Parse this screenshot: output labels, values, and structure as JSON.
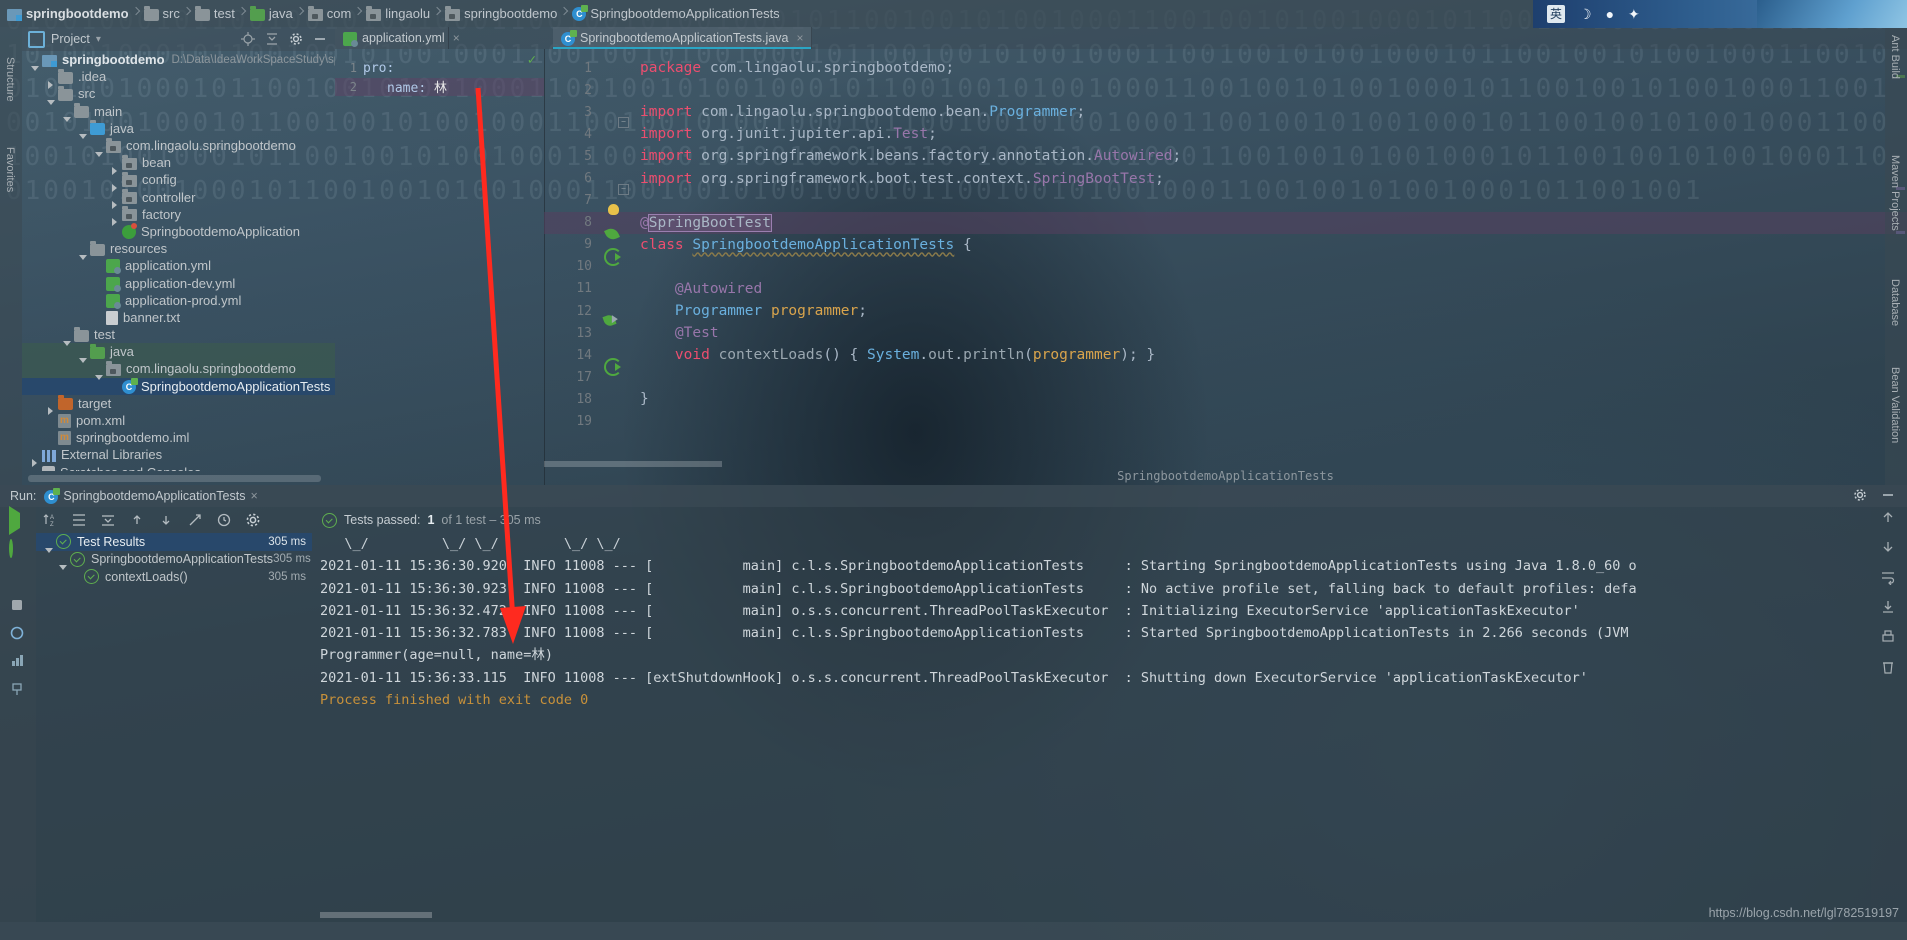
{
  "breadcrumb": {
    "items": [
      {
        "label": "springbootdemo",
        "icon": "module-icon",
        "bold": true
      },
      {
        "label": "src",
        "icon": "folder-icon"
      },
      {
        "label": "test",
        "icon": "folder-icon"
      },
      {
        "label": "java",
        "icon": "folder-green-icon"
      },
      {
        "label": "com",
        "icon": "package-icon"
      },
      {
        "label": "lingaolu",
        "icon": "package-icon"
      },
      {
        "label": "springbootdemo",
        "icon": "package-icon"
      },
      {
        "label": "SpringbootdemoApplicationTests",
        "icon": "class-test-icon"
      }
    ]
  },
  "project_panel": {
    "title": "Project",
    "tree": [
      {
        "indent": 0,
        "twist": "open",
        "icon": "module-icon",
        "label": "springbootdemo",
        "bold": true,
        "path": "D:\\Data\\IdeaWorkSpaceStudy\\springbootd"
      },
      {
        "indent": 1,
        "twist": "closed",
        "icon": "folder-icon",
        "label": ".idea"
      },
      {
        "indent": 1,
        "twist": "open",
        "icon": "folder-icon",
        "label": "src"
      },
      {
        "indent": 2,
        "twist": "open",
        "icon": "folder-icon",
        "label": "main"
      },
      {
        "indent": 3,
        "twist": "open",
        "icon": "folder-blue-icon",
        "label": "java"
      },
      {
        "indent": 4,
        "twist": "open",
        "icon": "package-icon",
        "label": "com.lingaolu.springbootdemo"
      },
      {
        "indent": 5,
        "twist": "closed",
        "icon": "package-icon",
        "label": "bean"
      },
      {
        "indent": 5,
        "twist": "closed",
        "icon": "package-icon",
        "label": "config"
      },
      {
        "indent": 5,
        "twist": "closed",
        "icon": "package-icon",
        "label": "controller"
      },
      {
        "indent": 5,
        "twist": "closed",
        "icon": "package-icon",
        "label": "factory"
      },
      {
        "indent": 5,
        "twist": "none",
        "icon": "spring-class-icon",
        "label": "SpringbootdemoApplication"
      },
      {
        "indent": 3,
        "twist": "open",
        "icon": "resources-icon",
        "label": "resources"
      },
      {
        "indent": 4,
        "twist": "none",
        "icon": "yml-icon",
        "label": "application.yml"
      },
      {
        "indent": 4,
        "twist": "none",
        "icon": "yml-icon",
        "label": "application-dev.yml"
      },
      {
        "indent": 4,
        "twist": "none",
        "icon": "yml-icon",
        "label": "application-prod.yml"
      },
      {
        "indent": 4,
        "twist": "none",
        "icon": "txt-icon",
        "label": "banner.txt"
      },
      {
        "indent": 2,
        "twist": "open",
        "icon": "folder-icon",
        "label": "test"
      },
      {
        "indent": 3,
        "twist": "open",
        "icon": "folder-green-icon",
        "label": "java",
        "highlight": "green"
      },
      {
        "indent": 4,
        "twist": "open",
        "icon": "package-icon",
        "label": "com.lingaolu.springbootdemo",
        "highlight": "green"
      },
      {
        "indent": 5,
        "twist": "none",
        "icon": "class-test-icon",
        "label": "SpringbootdemoApplicationTests",
        "highlight": "selected"
      },
      {
        "indent": 1,
        "twist": "closed",
        "icon": "folder-orange-icon",
        "label": "target"
      },
      {
        "indent": 1,
        "twist": "none",
        "icon": "xml-icon",
        "label": "pom.xml"
      },
      {
        "indent": 1,
        "twist": "none",
        "icon": "iml-icon",
        "label": "springbootdemo.iml"
      },
      {
        "indent": 0,
        "twist": "closed",
        "icon": "library-icon",
        "label": "External Libraries"
      },
      {
        "indent": 0,
        "twist": "closed",
        "icon": "scratch-icon",
        "label": "Scratches and Consoles"
      }
    ]
  },
  "editor": {
    "tabs": [
      {
        "label": "application.yml",
        "icon": "yml-icon",
        "active": false,
        "close": "×"
      },
      {
        "label": "SpringbootdemoApplicationTests.java",
        "icon": "class-test-icon",
        "active": true,
        "close": "×"
      }
    ],
    "yml": {
      "lines": [
        {
          "num": "1",
          "key": "pro",
          "colon": ":",
          "value": "",
          "highlight": false
        },
        {
          "num": "2",
          "key": "name",
          "colon": ":",
          "value": " 林",
          "highlight": true
        }
      ],
      "check_icon": "✓"
    },
    "java_lines": [
      {
        "num": "1",
        "marker": "",
        "text": "package com.lingaolu.springbootdemo;"
      },
      {
        "num": "2",
        "marker": "",
        "text": ""
      },
      {
        "num": "3",
        "marker": "fold",
        "text": "import com.lingaolu.springbootdemo.bean.Programmer;"
      },
      {
        "num": "4",
        "marker": "",
        "text": "import org.junit.jupiter.api.Test;"
      },
      {
        "num": "5",
        "marker": "",
        "text": "import org.springframework.beans.factory.annotation.Autowired;"
      },
      {
        "num": "6",
        "marker": "fold",
        "text": "import org.springframework.boot.test.context.SpringBootTest;"
      },
      {
        "num": "7",
        "marker": "bulb",
        "text": ""
      },
      {
        "num": "8",
        "marker": "leaf",
        "text": "@SpringBootTest",
        "current": true
      },
      {
        "num": "9",
        "marker": "run",
        "text": "class SpringbootdemoApplicationTests {"
      },
      {
        "num": "10",
        "marker": "",
        "text": ""
      },
      {
        "num": "11",
        "marker": "",
        "text": "    @Autowired"
      },
      {
        "num": "12",
        "marker": "bean",
        "text": "    Programmer programmer;"
      },
      {
        "num": "13",
        "marker": "",
        "text": "    @Test"
      },
      {
        "num": "14",
        "marker": "run",
        "text": "    void contextLoads() { System.out.println(programmer); }"
      },
      {
        "num": "17",
        "marker": "",
        "text": ""
      },
      {
        "num": "18",
        "marker": "",
        "text": "}"
      },
      {
        "num": "19",
        "marker": "",
        "text": ""
      }
    ],
    "footer_breadcrumb": "SpringbootdemoApplicationTests"
  },
  "run_window": {
    "title": "Run:",
    "config_name": "SpringbootdemoApplicationTests",
    "close": "×",
    "status_text_prefix": "Tests passed:",
    "status_count": "1",
    "status_text_suffix": "of 1 test – 305 ms",
    "results_tree": [
      {
        "indent": 0,
        "twist": "open",
        "label": "Test Results",
        "time": "305 ms",
        "selected": true,
        "check": false
      },
      {
        "indent": 1,
        "twist": "open",
        "label": "SpringbootdemoApplicationTests",
        "time": "305 ms",
        "check": true
      },
      {
        "indent": 2,
        "twist": "none",
        "label": "contextLoads()",
        "time": "305 ms",
        "check": true
      }
    ],
    "console_lines": [
      {
        "type": "banner",
        "text": "   \\_/         \\_/ \\_/        \\_/ \\_/"
      },
      {
        "type": "log",
        "text": "2021-01-11 15:36:30.920  INFO 11008 --- [           main] c.l.s.SpringbootdemoApplicationTests     : Starting SpringbootdemoApplicationTests using Java 1.8.0_60 o"
      },
      {
        "type": "log",
        "text": "2021-01-11 15:36:30.923  INFO 11008 --- [           main] c.l.s.SpringbootdemoApplicationTests     : No active profile set, falling back to default profiles: defa"
      },
      {
        "type": "log",
        "text": "2021-01-11 15:36:32.472  INFO 11008 --- [           main] o.s.s.concurrent.ThreadPoolTaskExecutor  : Initializing ExecutorService 'applicationTaskExecutor'"
      },
      {
        "type": "log",
        "text": "2021-01-11 15:36:32.783  INFO 11008 --- [           main] c.l.s.SpringbootdemoApplicationTests     : Started SpringbootdemoApplicationTests in 2.266 seconds (JVM"
      },
      {
        "type": "out",
        "text": "Programmer(age=null, name=林)"
      },
      {
        "type": "log",
        "text": "2021-01-11 15:36:33.115  INFO 11008 --- [extShutdownHook] o.s.s.concurrent.ThreadPoolTaskExecutor  : Shutting down ExecutorService 'applicationTaskExecutor'"
      },
      {
        "type": "blank",
        "text": ""
      },
      {
        "type": "exit",
        "text": "Process finished with exit code 0"
      }
    ]
  },
  "right_strip": {
    "items": [
      "Ant Build",
      "Maven Projects",
      "Database",
      "Bean Validation"
    ]
  },
  "left_strip": {
    "items": [
      "Structure",
      "Favorites"
    ]
  },
  "tray": {
    "ime_label": "英",
    "moon_icon": "☽",
    "dot_icon": "●",
    "star_icon": "✦"
  },
  "watermark": {
    "text": "https://blog.csdn.net/lgl782519197"
  },
  "colors": {
    "accent": "#2ba5c4",
    "selection": "#28486b",
    "green": "#4fa83f",
    "orange": "#c8913a",
    "red_arrow": "#ff2a1f",
    "keyword": "#cc7832",
    "annotation": "#bbb529"
  }
}
